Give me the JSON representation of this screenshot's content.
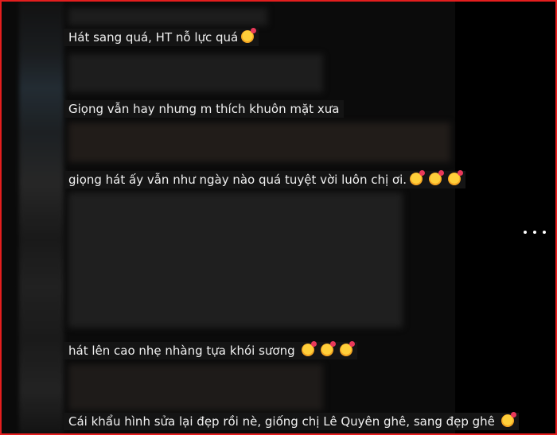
{
  "comments": [
    {
      "text": "Hát sang quá, HT nỗ lực quá",
      "emoji_count": 1
    },
    {
      "text": "Giọng vẫn hay nhưng m thích khuôn mặt xưa",
      "emoji_count": 0
    },
    {
      "text": "giọng hát ấy vẫn như ngày nào quá tuyệt vời luôn chị ơi.",
      "emoji_count": 3
    },
    {
      "text": "hát lên cao nhẹ nhàng tựa khói sương",
      "emoji_count": 3
    },
    {
      "text": "Cái khẩu hình sửa lại đẹp rồi nè, giống chị Lê Quyên ghê, sang đẹp ghê",
      "emoji_count": 1
    }
  ],
  "emoji_icon": "smiling-face-with-hearts-icon",
  "more_icon": "more-horizontal-icon",
  "colors": {
    "border": "#e41e1e",
    "background": "#0b0b0b",
    "text": "#f0f0f0"
  }
}
